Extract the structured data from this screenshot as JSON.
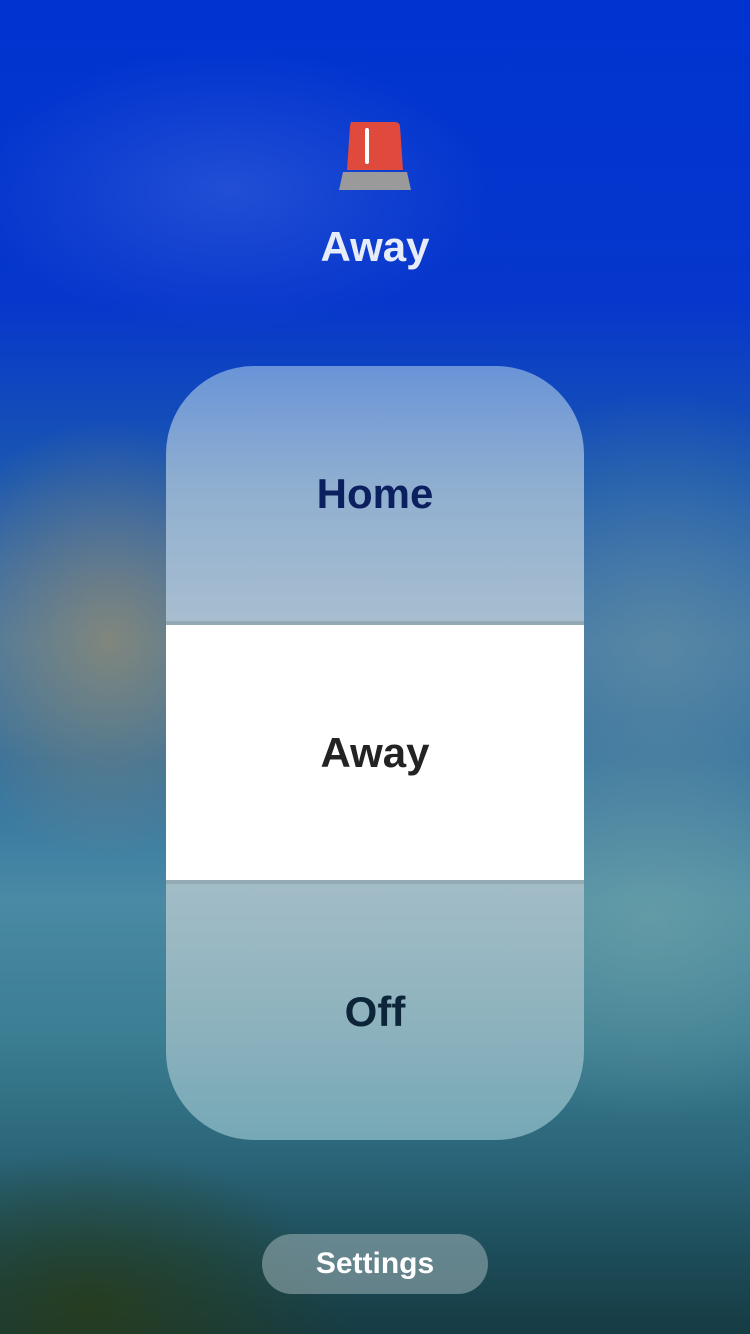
{
  "header": {
    "icon": "siren-icon",
    "current_mode": "Away"
  },
  "modes": {
    "selected": "Away",
    "options": [
      {
        "label": "Home"
      },
      {
        "label": "Away"
      },
      {
        "label": "Off"
      }
    ]
  },
  "footer": {
    "settings_label": "Settings"
  },
  "colors": {
    "siren_red": "#e04a3c",
    "siren_base": "#9a9a9a",
    "selected_background": "#ffffff"
  }
}
